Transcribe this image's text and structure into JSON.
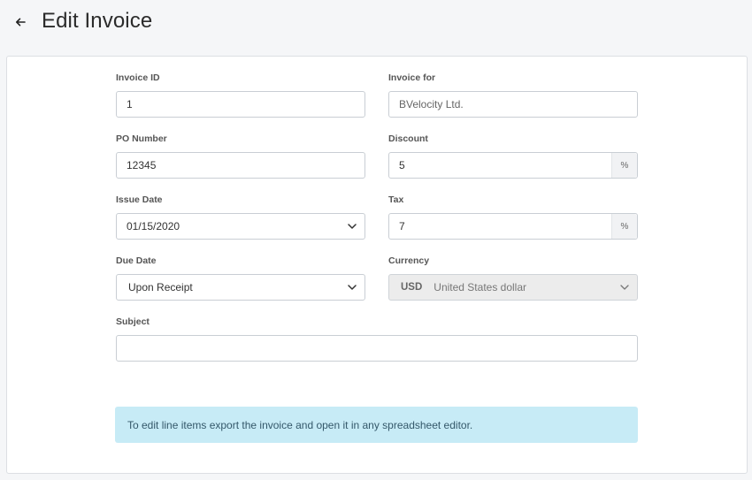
{
  "header": {
    "title": "Edit Invoice",
    "back_icon": "arrow-left-icon"
  },
  "form": {
    "invoice_id": {
      "label": "Invoice ID",
      "value": "1"
    },
    "invoice_for": {
      "label": "Invoice for",
      "placeholder": "BVelocity Ltd."
    },
    "po_number": {
      "label": "PO Number",
      "value": "12345"
    },
    "discount": {
      "label": "Discount",
      "value": "5",
      "suffix": "%"
    },
    "issue_date": {
      "label": "Issue Date",
      "value": "01/15/2020"
    },
    "tax": {
      "label": "Tax",
      "value": "7",
      "suffix": "%"
    },
    "due_date": {
      "label": "Due Date",
      "value": "Upon Receipt"
    },
    "currency": {
      "label": "Currency",
      "code": "USD",
      "name": "United States dollar"
    },
    "subject": {
      "label": "Subject",
      "value": ""
    }
  },
  "alert": {
    "text": "To edit line items export the invoice and open it in any spreadsheet editor."
  }
}
